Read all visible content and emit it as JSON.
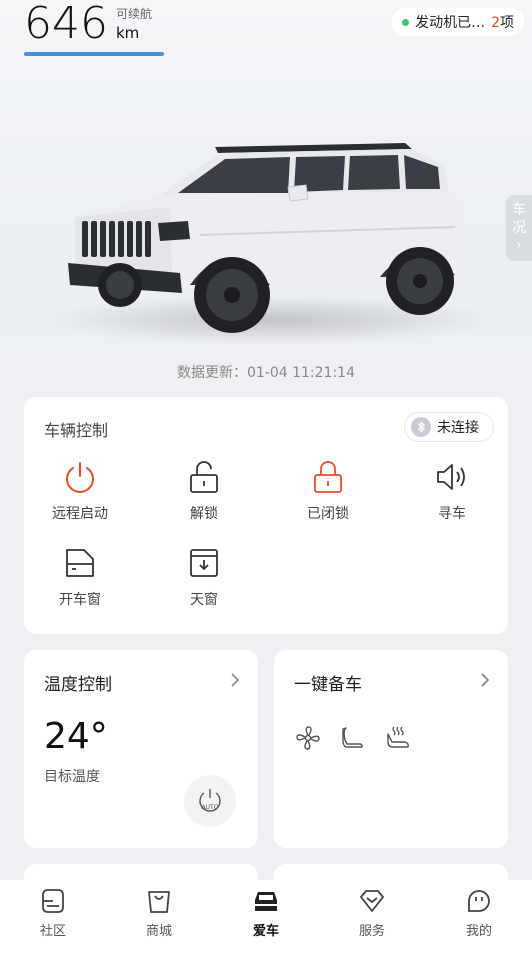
{
  "range": {
    "value": "646",
    "label": "可续航",
    "unit": "km"
  },
  "status": {
    "text": "发动机已…",
    "count": "2",
    "suffix": "项"
  },
  "side_tab": {
    "line1": "车",
    "line2": "况"
  },
  "update": {
    "text": "数据更新：01-04 11:21:14"
  },
  "vehicle_control": {
    "title": "车辆控制",
    "connection": "未连接",
    "controls": [
      {
        "label": "远程启动",
        "icon": "power-icon"
      },
      {
        "label": "解锁",
        "icon": "unlock-icon"
      },
      {
        "label": "已闭锁",
        "icon": "lock-icon"
      },
      {
        "label": "寻车",
        "icon": "speaker-icon"
      },
      {
        "label": "开车窗",
        "icon": "window-icon"
      },
      {
        "label": "天窗",
        "icon": "sunroof-icon"
      }
    ]
  },
  "temperature": {
    "title": "温度控制",
    "value": "24°",
    "subtitle": "目标温度",
    "auto_label": "AUTO"
  },
  "prep": {
    "title": "一键备车",
    "icons": [
      "fan-icon",
      "seat-icon",
      "seat-heat-icon"
    ]
  },
  "tabbar": {
    "items": [
      {
        "label": "社区",
        "active": false
      },
      {
        "label": "商城",
        "active": false
      },
      {
        "label": "爱车",
        "active": true
      },
      {
        "label": "服务",
        "active": false
      },
      {
        "label": "我的",
        "active": false
      }
    ]
  },
  "colors": {
    "accent_orange": "#e0502a",
    "range_bar": "#4a90d9",
    "status_green": "#35c76c"
  }
}
